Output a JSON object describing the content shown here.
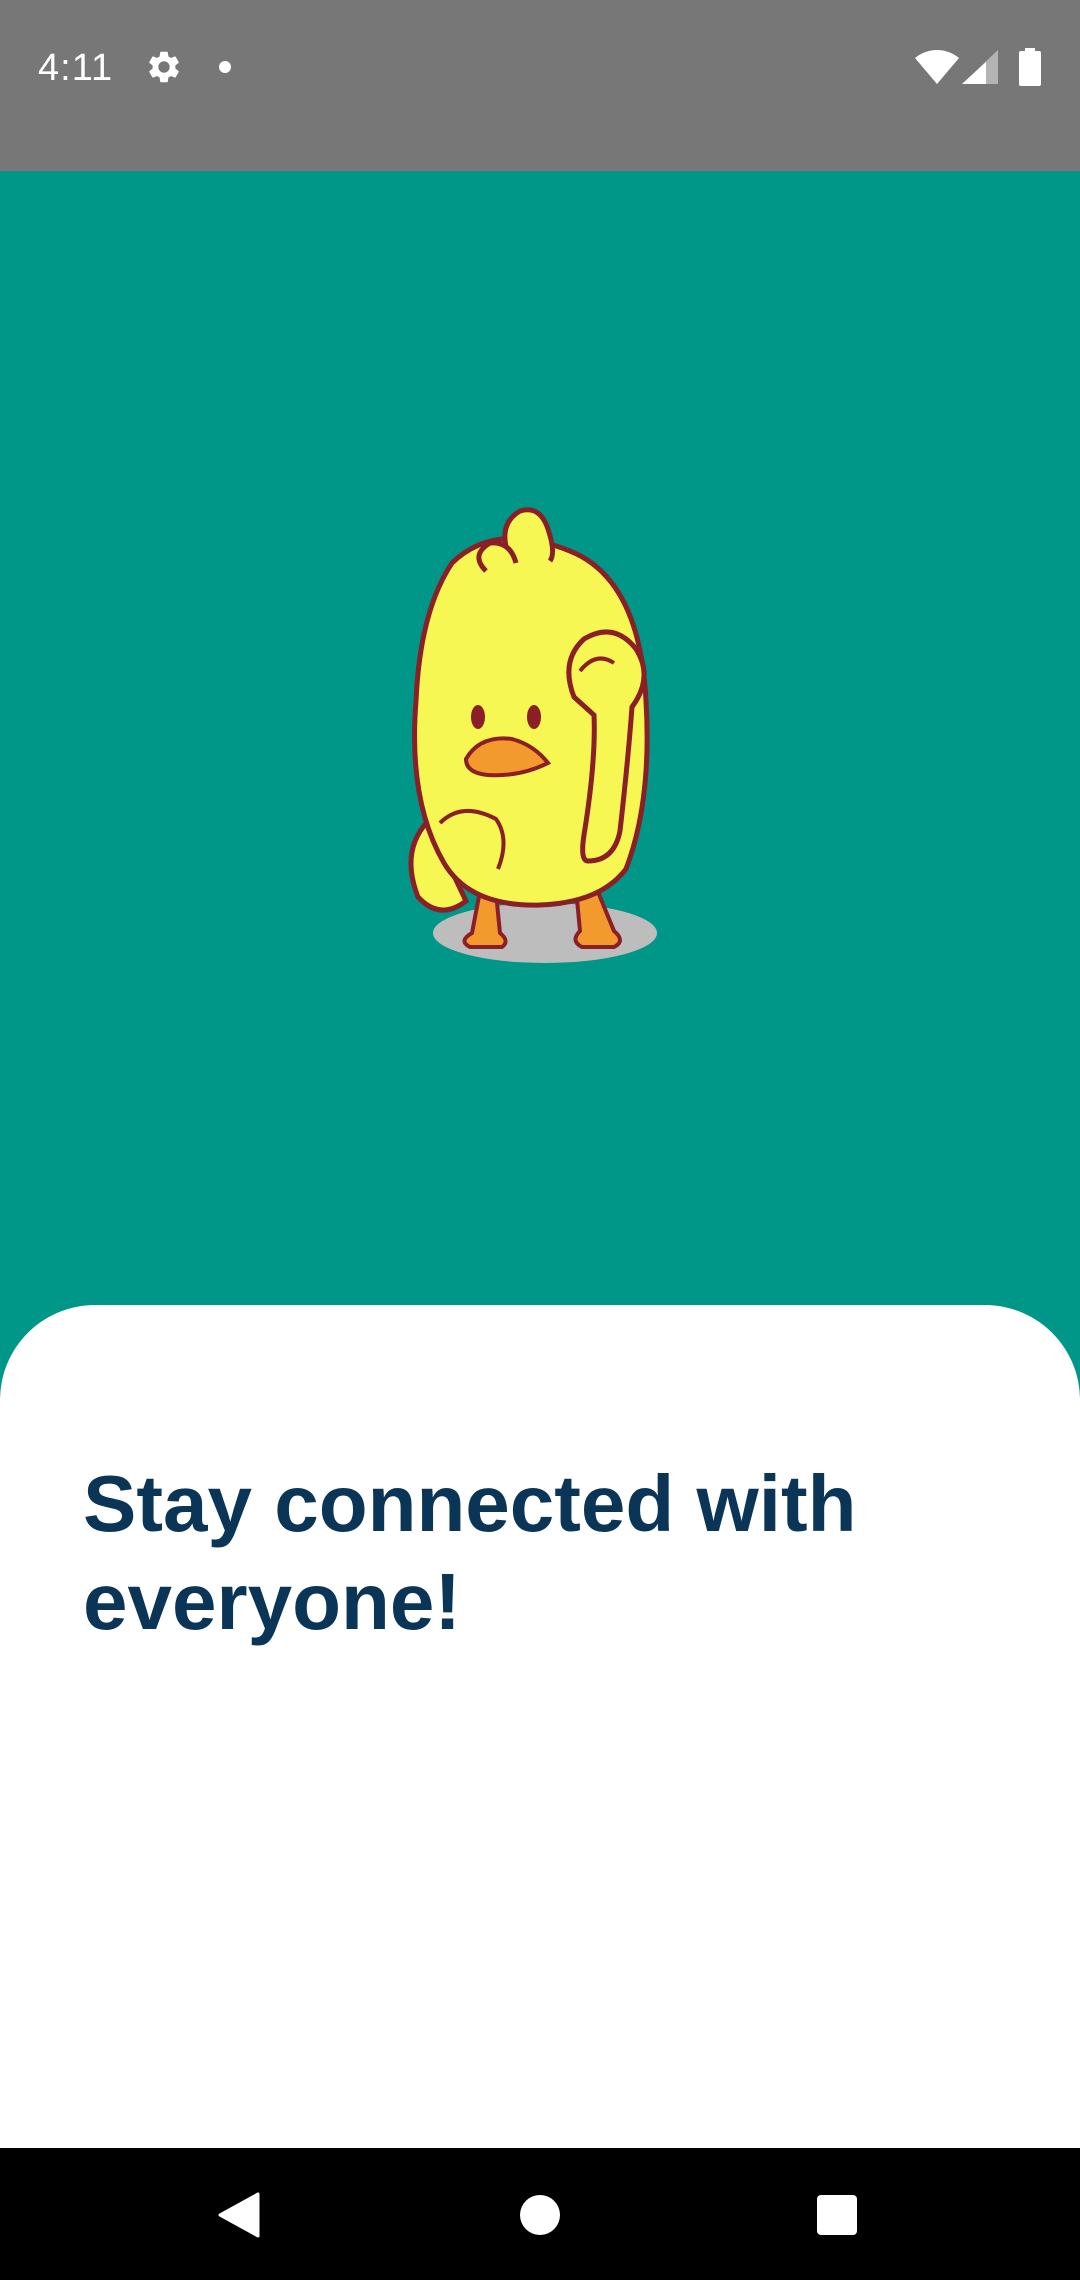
{
  "status_bar": {
    "time": "4:11",
    "icons": [
      "gear-icon",
      "notification-dot-icon",
      "wifi-icon",
      "signal-icon",
      "battery-icon"
    ],
    "background_color": "#777777"
  },
  "hero": {
    "background_color": "#009688",
    "illustration": "dancing-duck-illustration"
  },
  "card": {
    "title": "Stay connected with everyone!",
    "title_color": "#0b3557",
    "background_color": "#ffffff"
  },
  "nav_bar": {
    "icons": [
      "back-icon",
      "home-icon",
      "recents-icon"
    ],
    "background_color": "#000000"
  }
}
